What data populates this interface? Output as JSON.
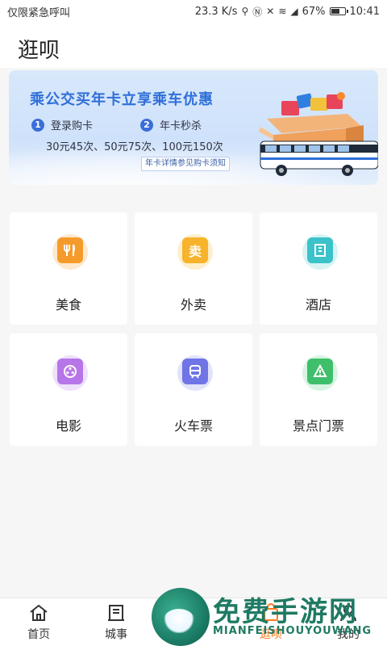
{
  "status_bar": {
    "carrier": "仅限紧急呼叫",
    "speed": "23.3 K/s",
    "battery": "67%",
    "battery_level": 0.67,
    "time": "10:41"
  },
  "header": {
    "title": "逛呗"
  },
  "banner": {
    "title": "乘公交买年卡立享乘车优惠",
    "step1_num": "1",
    "step1_label": "登录购卡",
    "step2_num": "2",
    "step2_label": "年卡秒杀",
    "prices": "30元45次、50元75次、100元150次",
    "note": "年卡详情参见购卡须知",
    "colors": {
      "title": "#2f6fd9",
      "bg": "#d8e8fb"
    }
  },
  "services": [
    {
      "label": "美食",
      "icon": "restaurant-icon",
      "color": "#f59b2c",
      "halo": "#fde9cf"
    },
    {
      "label": "外卖",
      "icon": "takeout-icon",
      "glyph": "卖",
      "color": "#f7b32b",
      "halo": "#fdefcd"
    },
    {
      "label": "酒店",
      "icon": "hotel-icon",
      "color": "#3cc2c9",
      "halo": "#d7f3f4"
    },
    {
      "label": "电影",
      "icon": "film-reel-icon",
      "color": "#b776e8",
      "halo": "#efe0fb"
    },
    {
      "label": "火车票",
      "icon": "train-icon",
      "color": "#6f74e6",
      "halo": "#e2e3fb"
    },
    {
      "label": "景点门票",
      "icon": "scenic-ticket-icon",
      "color": "#3fbf6b",
      "halo": "#d9f4e2"
    }
  ],
  "tabbar": {
    "items": [
      {
        "label": "首页",
        "icon": "home-icon"
      },
      {
        "label": "城事",
        "icon": "building-icon"
      },
      {
        "label": "",
        "icon": ""
      },
      {
        "label": "逛呗",
        "icon": "shopping-bag-icon",
        "active": true
      },
      {
        "label": "我的",
        "icon": "user-icon"
      }
    ]
  },
  "watermark": {
    "text": "免费手游网",
    "sub": "MIANFEISHOUYOUWANG"
  }
}
